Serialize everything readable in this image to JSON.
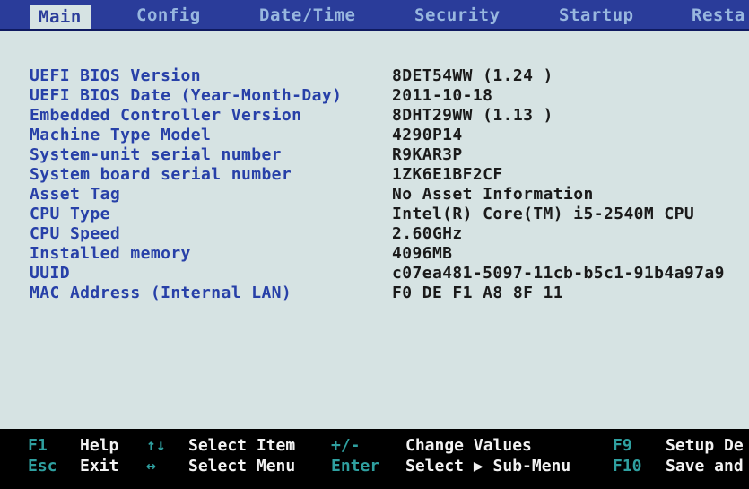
{
  "tabs": [
    {
      "label": "Main",
      "active": true
    },
    {
      "label": "Config",
      "active": false
    },
    {
      "label": "Date/Time",
      "active": false
    },
    {
      "label": "Security",
      "active": false
    },
    {
      "label": "Startup",
      "active": false
    },
    {
      "label": "Resta",
      "active": false
    }
  ],
  "info": [
    {
      "label": "UEFI BIOS Version",
      "value": "8DET54WW (1.24 )"
    },
    {
      "label": "UEFI BIOS Date (Year-Month-Day)",
      "value": "2011-10-18"
    },
    {
      "label": "Embedded Controller Version",
      "value": "8DHT29WW (1.13 )"
    },
    {
      "label": "Machine Type Model",
      "value": "4290P14"
    },
    {
      "label": "System-unit serial number",
      "value": "R9KAR3P"
    },
    {
      "label": "System board serial number",
      "value": "1ZK6E1BF2CF"
    },
    {
      "label": "Asset Tag",
      "value": "No Asset Information"
    },
    {
      "label": "CPU Type",
      "value": "Intel(R) Core(TM) i5-2540M CPU"
    },
    {
      "label": "CPU Speed",
      "value": "2.60GHz"
    },
    {
      "label": "Installed memory",
      "value": "4096MB"
    },
    {
      "label": "UUID",
      "value": "c07ea481-5097-11cb-b5c1-91b4a97a9"
    },
    {
      "label": "MAC Address (Internal LAN)",
      "value": "F0 DE F1 A8 8F 11"
    }
  ],
  "help": {
    "row1": [
      {
        "key": "F1",
        "desc": "Help"
      },
      {
        "key": "↑↓",
        "desc": "Select Item"
      },
      {
        "key": "+/-",
        "desc": "Change Values"
      },
      {
        "key": "F9",
        "desc": "Setup De"
      }
    ],
    "row2": [
      {
        "key": "Esc",
        "desc": "Exit"
      },
      {
        "key": "↔",
        "desc": "Select Menu"
      },
      {
        "key": "Enter",
        "desc": "Select ▶ Sub-Menu"
      },
      {
        "key": "F10",
        "desc": "Save and"
      }
    ]
  },
  "colors": {
    "tab_bar": "#2a3c9a",
    "tab_text": "#98b7df",
    "label_text": "#2740a8",
    "value_text": "#1a1a1a",
    "content_bg": "#d6e3e3",
    "help_key": "#2fa0a0",
    "help_desc": "#f2f2f2"
  }
}
